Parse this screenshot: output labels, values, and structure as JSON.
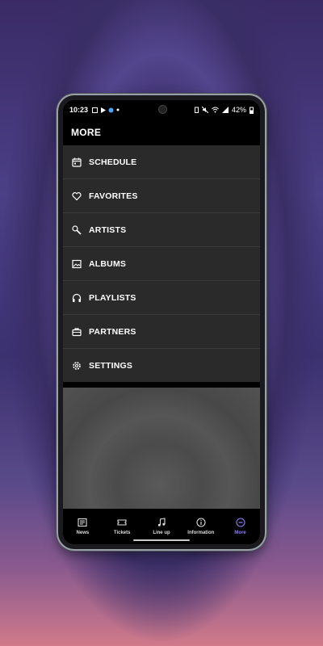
{
  "status_bar": {
    "time": "10:23",
    "battery": "42%"
  },
  "header": {
    "title": "MORE"
  },
  "menu": {
    "items": [
      {
        "label": "SCHEDULE",
        "icon": "calendar-icon"
      },
      {
        "label": "FAVORITES",
        "icon": "heart-icon"
      },
      {
        "label": "ARTISTS",
        "icon": "microphone-icon"
      },
      {
        "label": "ALBUMS",
        "icon": "image-icon"
      },
      {
        "label": "PLAYLISTS",
        "icon": "headphones-icon"
      },
      {
        "label": "PARTNERS",
        "icon": "briefcase-icon"
      },
      {
        "label": "SETTINGS",
        "icon": "gear-icon"
      }
    ]
  },
  "tabbar": {
    "tabs": [
      {
        "label": "News",
        "icon": "news-icon"
      },
      {
        "label": "Tickets",
        "icon": "ticket-icon"
      },
      {
        "label": "Line up",
        "icon": "music-note-icon"
      },
      {
        "label": "Information",
        "icon": "info-icon"
      },
      {
        "label": "More",
        "icon": "more-icon",
        "active": true
      }
    ]
  },
  "colors": {
    "accent": "#8b7ef0",
    "menu_bg": "#2a2a2a",
    "header_bg": "#000000"
  }
}
